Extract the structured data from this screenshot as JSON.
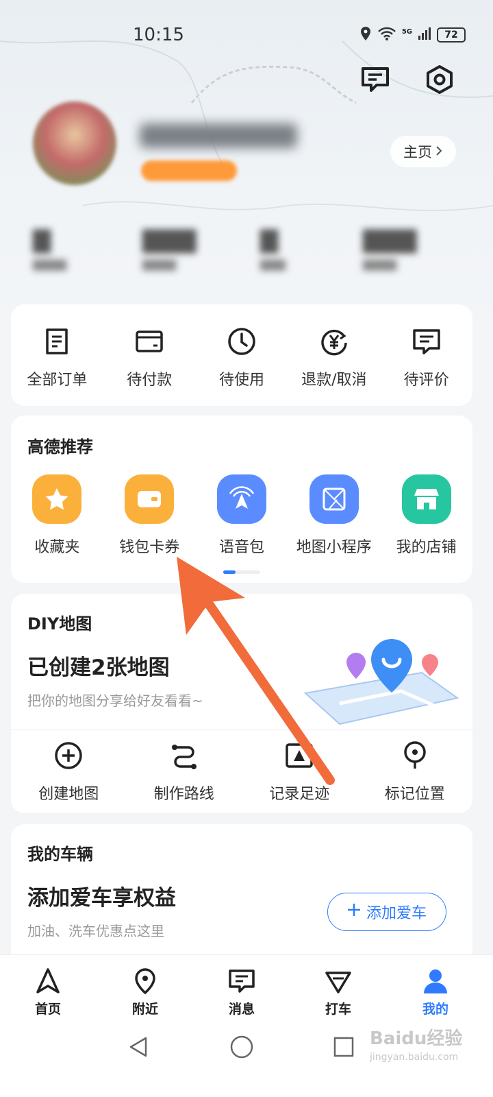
{
  "status": {
    "time": "10:15",
    "battery": "72",
    "network": "5G"
  },
  "header": {
    "home_label": "主页"
  },
  "orders": {
    "items": [
      {
        "label": "全部订单",
        "icon": "order-list-icon"
      },
      {
        "label": "待付款",
        "icon": "wallet-card-icon"
      },
      {
        "label": "待使用",
        "icon": "clock-icon"
      },
      {
        "label": "退款/取消",
        "icon": "refund-yen-icon"
      },
      {
        "label": "待评价",
        "icon": "comment-icon"
      }
    ]
  },
  "recommend": {
    "title": "高德推荐",
    "items": [
      {
        "label": "收藏夹",
        "icon": "star-icon",
        "color": "#fbb03b"
      },
      {
        "label": "钱包卡券",
        "icon": "wallet-icon",
        "color": "#fbb03b"
      },
      {
        "label": "语音包",
        "icon": "voice-nav-icon",
        "color": "#5b8cff"
      },
      {
        "label": "地图小程序",
        "icon": "mini-program-icon",
        "color": "#5b8cff"
      },
      {
        "label": "我的店铺",
        "icon": "shop-icon",
        "color": "#26c6a0"
      }
    ]
  },
  "diy": {
    "title": "DIY地图",
    "headline": "已创建2张地图",
    "subtitle": "把你的地图分享给好友看看~",
    "actions": [
      {
        "label": "创建地图",
        "icon": "plus-circle-icon"
      },
      {
        "label": "制作路线",
        "icon": "route-icon"
      },
      {
        "label": "记录足迹",
        "icon": "camera-icon"
      },
      {
        "label": "标记位置",
        "icon": "location-pin-icon"
      }
    ]
  },
  "vehicle": {
    "title": "我的车辆",
    "headline": "添加爱车享权益",
    "subtitle": "加油、洗车优惠点这里",
    "button": "添加爱车"
  },
  "nav": {
    "items": [
      {
        "label": "首页",
        "icon": "navigate-arrow-icon"
      },
      {
        "label": "附近",
        "icon": "nearby-pin-icon"
      },
      {
        "label": "消息",
        "icon": "message-icon"
      },
      {
        "label": "打车",
        "icon": "taxi-icon"
      },
      {
        "label": "我的",
        "icon": "person-icon",
        "active": true
      }
    ]
  },
  "watermark": {
    "brand": "Baidu经验",
    "url": "jingyan.baidu.com"
  },
  "colors": {
    "accent": "#2f7bff",
    "annotation_arrow": "#f26b3a"
  }
}
